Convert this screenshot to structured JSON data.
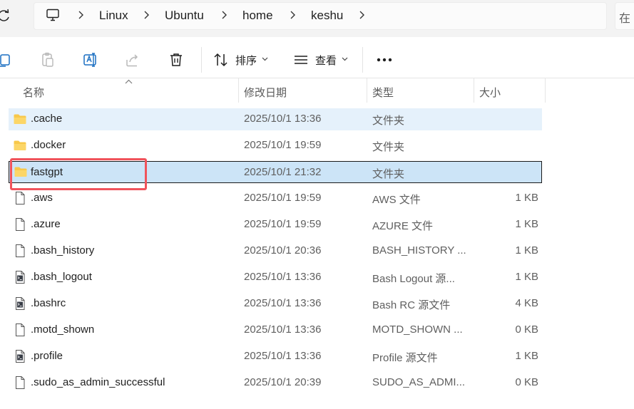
{
  "breadcrumbs": [
    "Linux",
    "Ubuntu",
    "home",
    "keshu"
  ],
  "search_hint": "在",
  "toolbar": {
    "sort_label": "排序",
    "view_label": "查看"
  },
  "columns": {
    "name": "名称",
    "modified": "修改日期",
    "type": "类型",
    "size": "大小"
  },
  "files": [
    {
      "name": ".cache",
      "modified": "2025/10/1 13:36",
      "type": "文件夹",
      "size": "",
      "icon": "folder-icon"
    },
    {
      "name": ".docker",
      "modified": "2025/10/1 19:59",
      "type": "文件夹",
      "size": "",
      "icon": "folder-icon"
    },
    {
      "name": "fastgpt",
      "modified": "2025/10/1 21:32",
      "type": "文件夹",
      "size": "",
      "icon": "folder-icon"
    },
    {
      "name": ".aws",
      "modified": "2025/10/1 19:59",
      "type": "AWS 文件",
      "size": "1 KB",
      "icon": "file-icon"
    },
    {
      "name": ".azure",
      "modified": "2025/10/1 19:59",
      "type": "AZURE 文件",
      "size": "1 KB",
      "icon": "file-icon"
    },
    {
      "name": ".bash_history",
      "modified": "2025/10/1 20:36",
      "type": "BASH_HISTORY ...",
      "size": "1 KB",
      "icon": "file-icon"
    },
    {
      "name": ".bash_logout",
      "modified": "2025/10/1 13:36",
      "type": "Bash Logout 源...",
      "size": "1 KB",
      "icon": "script-file-icon"
    },
    {
      "name": ".bashrc",
      "modified": "2025/10/1 13:36",
      "type": "Bash RC 源文件",
      "size": "4 KB",
      "icon": "script-file-icon"
    },
    {
      "name": ".motd_shown",
      "modified": "2025/10/1 13:36",
      "type": "MOTD_SHOWN ...",
      "size": "0 KB",
      "icon": "file-icon"
    },
    {
      "name": ".profile",
      "modified": "2025/10/1 13:36",
      "type": "Profile 源文件",
      "size": "1 KB",
      "icon": "script-file-icon"
    },
    {
      "name": ".sudo_as_admin_successful",
      "modified": "2025/10/1 20:39",
      "type": "SUDO_AS_ADMI...",
      "size": "0 KB",
      "icon": "file-icon"
    }
  ],
  "colors": {
    "selection_light": "#e5f1fb",
    "selection_focus": "#cce4f7",
    "annotation": "#f0535b",
    "folder": "#f8c84a"
  }
}
